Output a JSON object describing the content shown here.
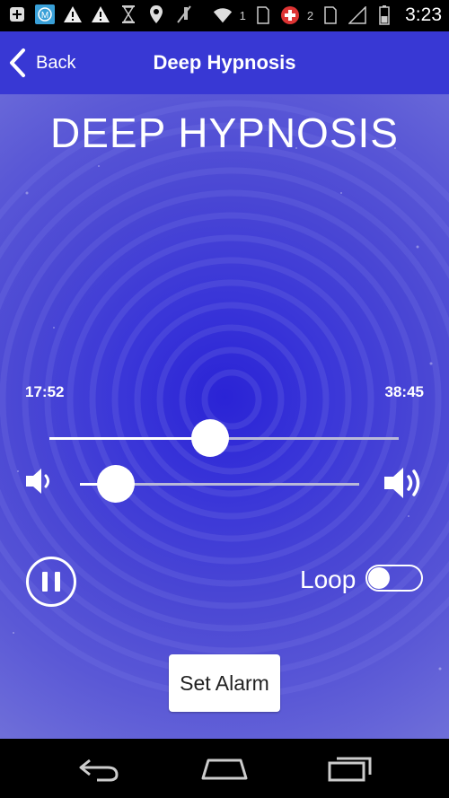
{
  "status_bar": {
    "time": "3:23",
    "sim1": "1",
    "sim2": "2",
    "icons": [
      "plus-box-icon",
      "m-app-icon",
      "warning-icon",
      "warning-icon",
      "hourglass-icon",
      "location-icon",
      "mute-icon",
      "wifi-icon",
      "sim-1-icon",
      "swiss-flag-icon",
      "sim-2-icon",
      "signal-icon",
      "battery-icon"
    ]
  },
  "action_bar": {
    "back_label": "Back",
    "title": "Deep Hypnosis"
  },
  "player": {
    "header": "DEEP HYPNOSIS",
    "elapsed": "17:52",
    "total": "38:45",
    "progress_fraction": 0.46,
    "volume_fraction": 0.13,
    "loop_label": "Loop",
    "loop_on": false,
    "state": "playing",
    "alarm_label": "Set Alarm"
  },
  "colors": {
    "action_bar": "#3838d4",
    "background_center": "#2a23d6",
    "background_edge": "#6f6fd9",
    "track": "#b9b9d8"
  }
}
